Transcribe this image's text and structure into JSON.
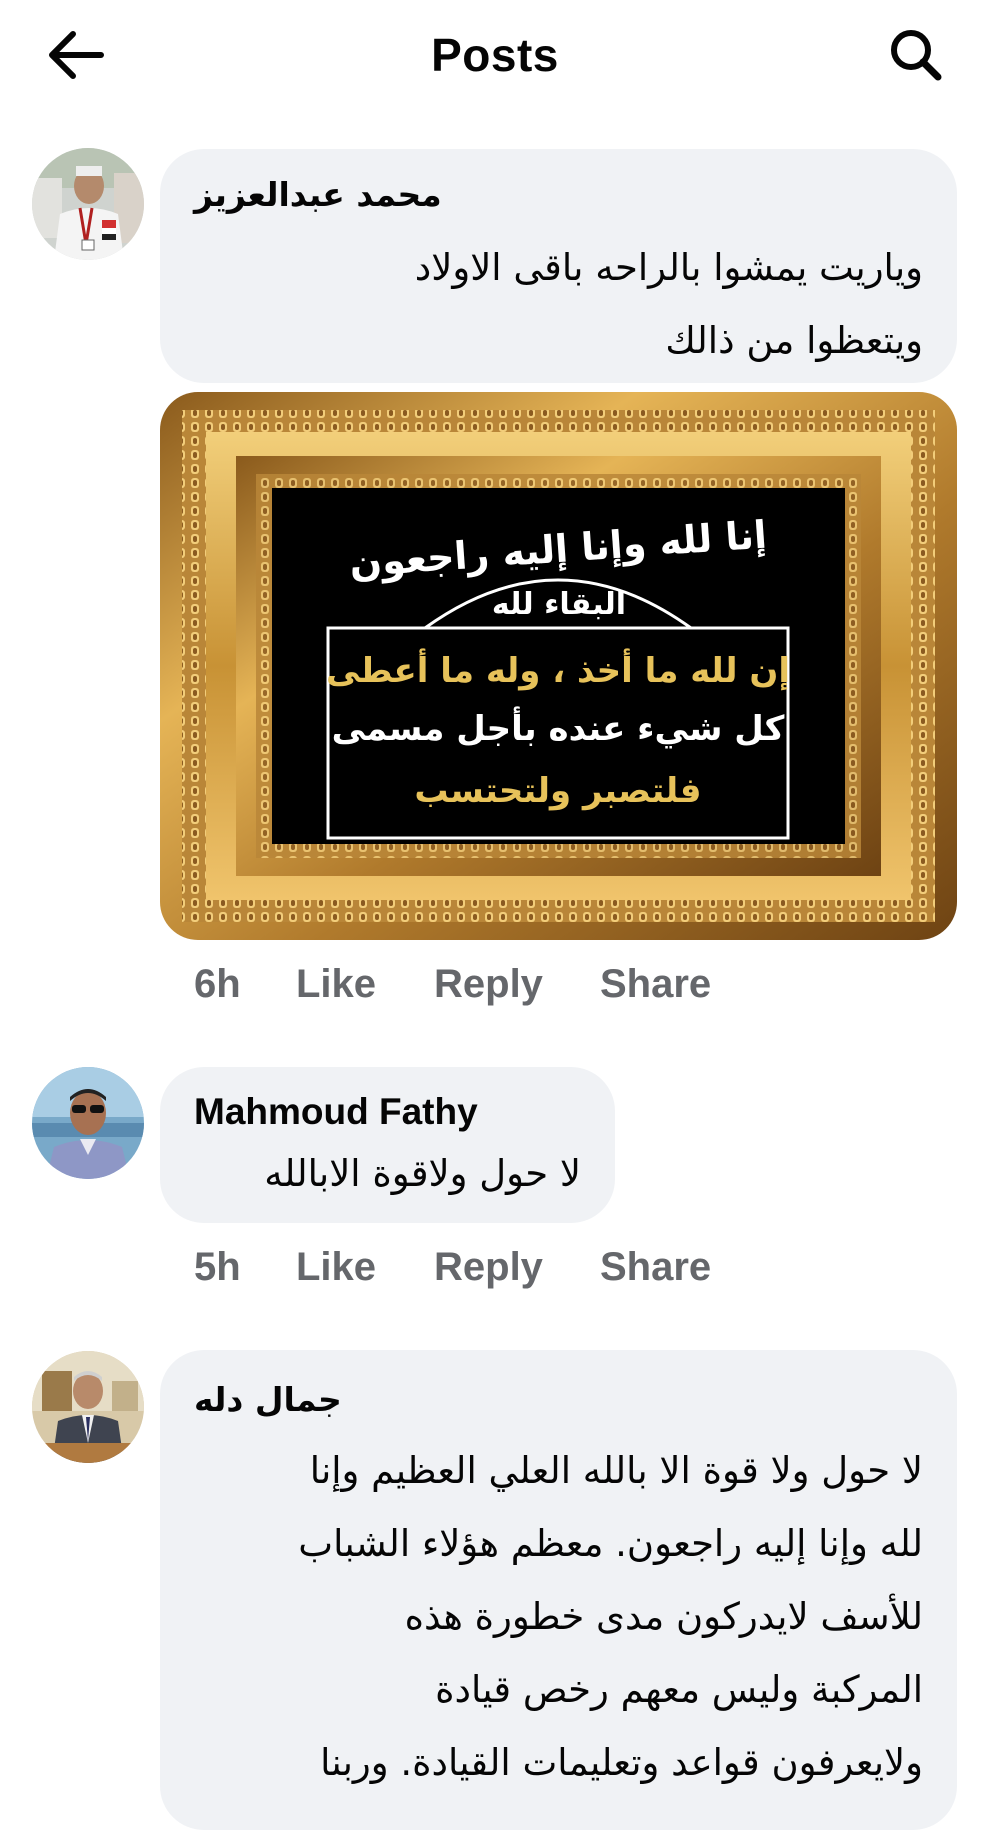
{
  "header": {
    "title": "Posts",
    "back_icon": "arrow-left-icon",
    "search_icon": "search-icon"
  },
  "comments": [
    {
      "author": "محمد عبدالعزيز",
      "lines": [
        "وياريت يمشوا بالراحه باقى الاولاد",
        "ويتعظوا من ذالك"
      ],
      "image": {
        "arc_text": "إنا لله وإنا إليه راجعون",
        "sub_text": "البقاء لله",
        "line1": "إن لله ما أخذ ، وله ما أعطى",
        "line2": "كل شيء عنده بأجل مسمى",
        "line3": "فلتصبر ولتحتسب"
      },
      "time": "6h",
      "like": "Like",
      "reply": "Reply",
      "share": "Share"
    },
    {
      "author": "Mahmoud Fathy",
      "lines": [
        "لا حول ولاقوة الابالله"
      ],
      "time": "5h",
      "like": "Like",
      "reply": "Reply",
      "share": "Share"
    },
    {
      "author": "جمال دله",
      "lines": [
        "لا حول ولا قوة الا بالله العلي العظيم وإنا",
        "لله وإنا إليه راجعون. معظم هؤلاء الشباب",
        "للأسف لايدركون مدى خطورة هذه",
        "المركبة وليس معهم رخص قيادة",
        "ولايعرفون قواعد وتعليمات القيادة. وربنا"
      ]
    }
  ],
  "colors": {
    "bubble": "#f0f2f5",
    "meta_text": "#65676b",
    "frame_gold": "#c8922f",
    "frame_inner": "#000000",
    "gold_text": "#e7c25a"
  }
}
